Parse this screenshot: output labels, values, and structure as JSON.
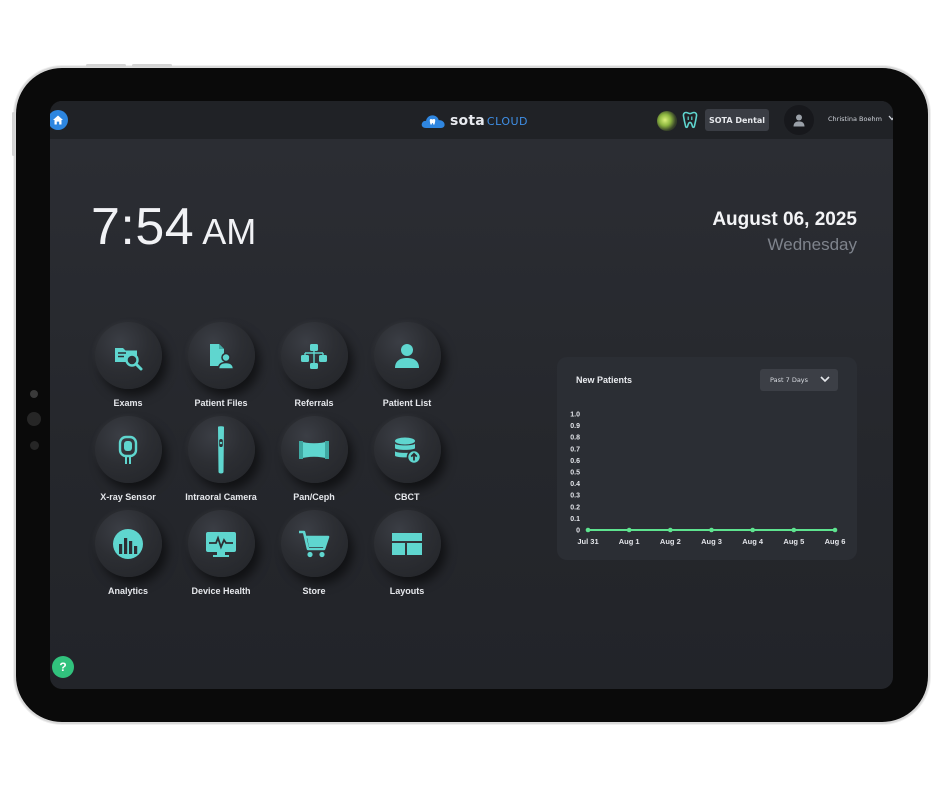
{
  "header": {
    "brand_primary": "sota",
    "brand_secondary": "CLOUD",
    "practice_button": "SOTA Dental",
    "user_name": "Christina Boehm",
    "home_icon": "home-icon",
    "theme_icon": "theme-toggle-icon",
    "tooth_icon": "tooth-icon",
    "avatar_icon": "user-avatar-icon"
  },
  "clock": {
    "time": "7:54",
    "ampm": "AM"
  },
  "date": {
    "date": "August 06, 2025",
    "weekday": "Wednesday"
  },
  "accent_color": "#5fd6cf",
  "apps": [
    {
      "label": "Exams",
      "icon": "exams-folder-search-icon"
    },
    {
      "label": "Patient Files",
      "icon": "patient-files-icon"
    },
    {
      "label": "Referrals",
      "icon": "referrals-icon"
    },
    {
      "label": "Patient List",
      "icon": "patient-list-icon"
    },
    {
      "label": "X-ray Sensor",
      "icon": "xray-sensor-icon"
    },
    {
      "label": "Intraoral Camera",
      "icon": "intraoral-camera-icon"
    },
    {
      "label": "Pan/Ceph",
      "icon": "pan-ceph-icon"
    },
    {
      "label": "CBCT",
      "icon": "cbct-icon"
    },
    {
      "label": "Analytics",
      "icon": "analytics-icon"
    },
    {
      "label": "Device Health",
      "icon": "device-health-icon"
    },
    {
      "label": "Store",
      "icon": "store-cart-icon"
    },
    {
      "label": "Layouts",
      "icon": "layouts-icon"
    }
  ],
  "new_patients": {
    "title": "New Patients",
    "range_select": "Past 7 Days"
  },
  "chart_data": {
    "type": "line",
    "title": "New Patients",
    "categories": [
      "Jul 31",
      "Aug 1",
      "Aug 2",
      "Aug 3",
      "Aug 4",
      "Aug 5",
      "Aug 6"
    ],
    "series": [
      {
        "values": [
          0,
          0,
          0,
          0,
          0,
          0,
          0
        ],
        "color": "#5ee38f"
      }
    ],
    "ylim": [
      0,
      1.0
    ],
    "yticks": [
      "0",
      "0.1",
      "0.2",
      "0.3",
      "0.4",
      "0.5",
      "0.6",
      "0.7",
      "0.8",
      "0.9",
      "1.0"
    ],
    "grid": false
  },
  "help": {
    "label": "?"
  }
}
